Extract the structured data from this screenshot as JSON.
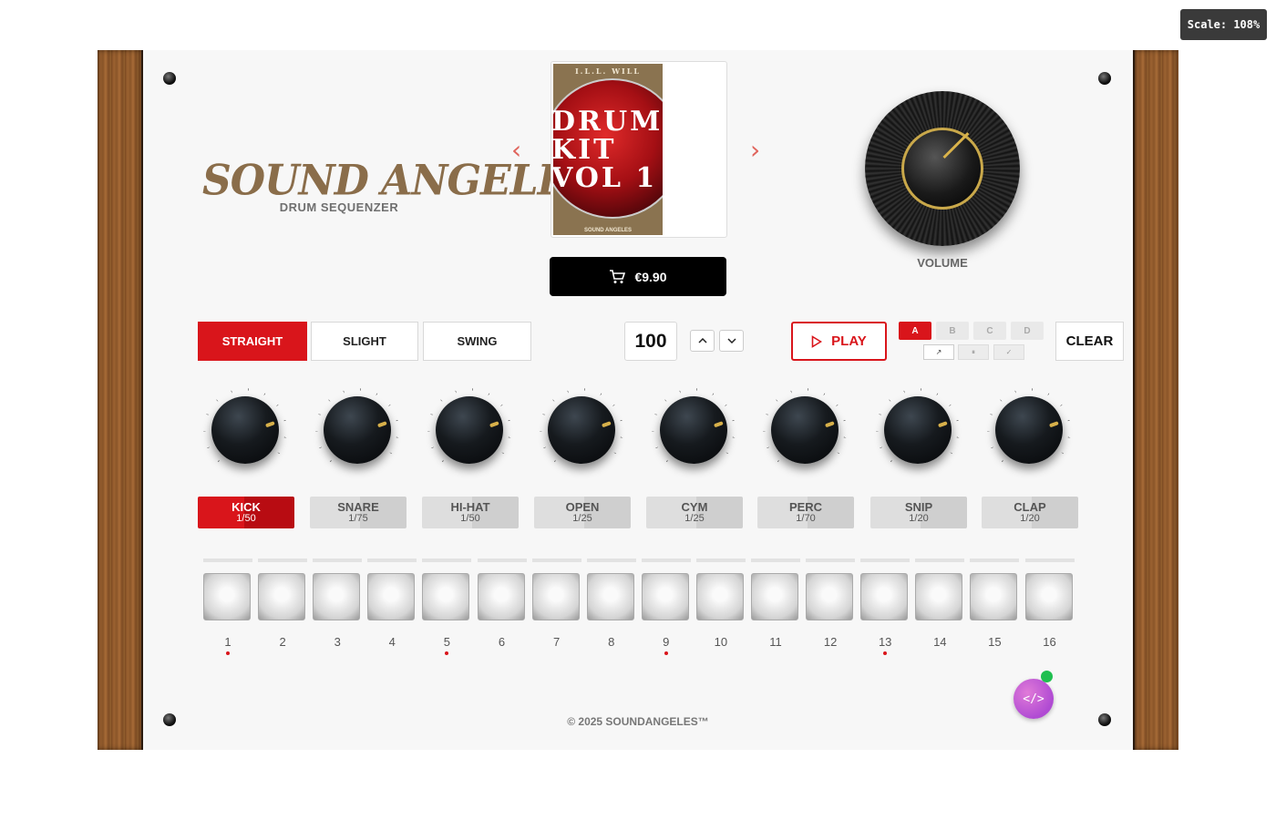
{
  "scale_badge": "Scale: 108%",
  "brand": {
    "name": "SOUND ANGELES",
    "subtitle": "DRUM SEQUENZER",
    "color": "#8a6d4a"
  },
  "kit": {
    "prev_icon": "chevron-left-icon",
    "next_icon": "chevron-right-icon",
    "cover_top": "I.L.L. WILL",
    "cover_title_lines": [
      "DRUM",
      "KIT",
      "VOL 1"
    ],
    "cover_bottom": "SOUND ANGELES",
    "price": "€9.90",
    "cart_icon": "cart-icon"
  },
  "volume": {
    "label": "VOLUME"
  },
  "swing": {
    "options": [
      "STRAIGHT",
      "SLIGHT",
      "SWING"
    ],
    "selected": "STRAIGHT"
  },
  "tempo": {
    "bpm": "100"
  },
  "transport": {
    "play_label": "PLAY",
    "clear_label": "CLEAR"
  },
  "patterns": {
    "labels": [
      "A",
      "B",
      "C",
      "D"
    ],
    "selected": "A",
    "tools": [
      "↗",
      "⏸",
      "✓"
    ]
  },
  "channels": [
    {
      "name": "KICK",
      "rate": "1/50",
      "active": true
    },
    {
      "name": "SNARE",
      "rate": "1/75",
      "active": false
    },
    {
      "name": "HI-HAT",
      "rate": "1/50",
      "active": false
    },
    {
      "name": "OPEN",
      "rate": "1/25",
      "active": false
    },
    {
      "name": "CYM",
      "rate": "1/25",
      "active": false
    },
    {
      "name": "PERC",
      "rate": "1/70",
      "active": false
    },
    {
      "name": "SNIP",
      "rate": "1/20",
      "active": false
    },
    {
      "name": "CLAP",
      "rate": "1/20",
      "active": false
    }
  ],
  "steps": {
    "numbers": [
      "1",
      "2",
      "3",
      "4",
      "5",
      "6",
      "7",
      "8",
      "9",
      "10",
      "11",
      "12",
      "13",
      "14",
      "15",
      "16"
    ],
    "marked": [
      1,
      5,
      9,
      13
    ]
  },
  "footer": "© 2025 SOUNDANGELES™",
  "colors": {
    "accent": "#d9151b",
    "gold": "#d7b04a",
    "wood": "#8a5529",
    "fab": "#b04bd3",
    "online": "#1fbf4f"
  }
}
